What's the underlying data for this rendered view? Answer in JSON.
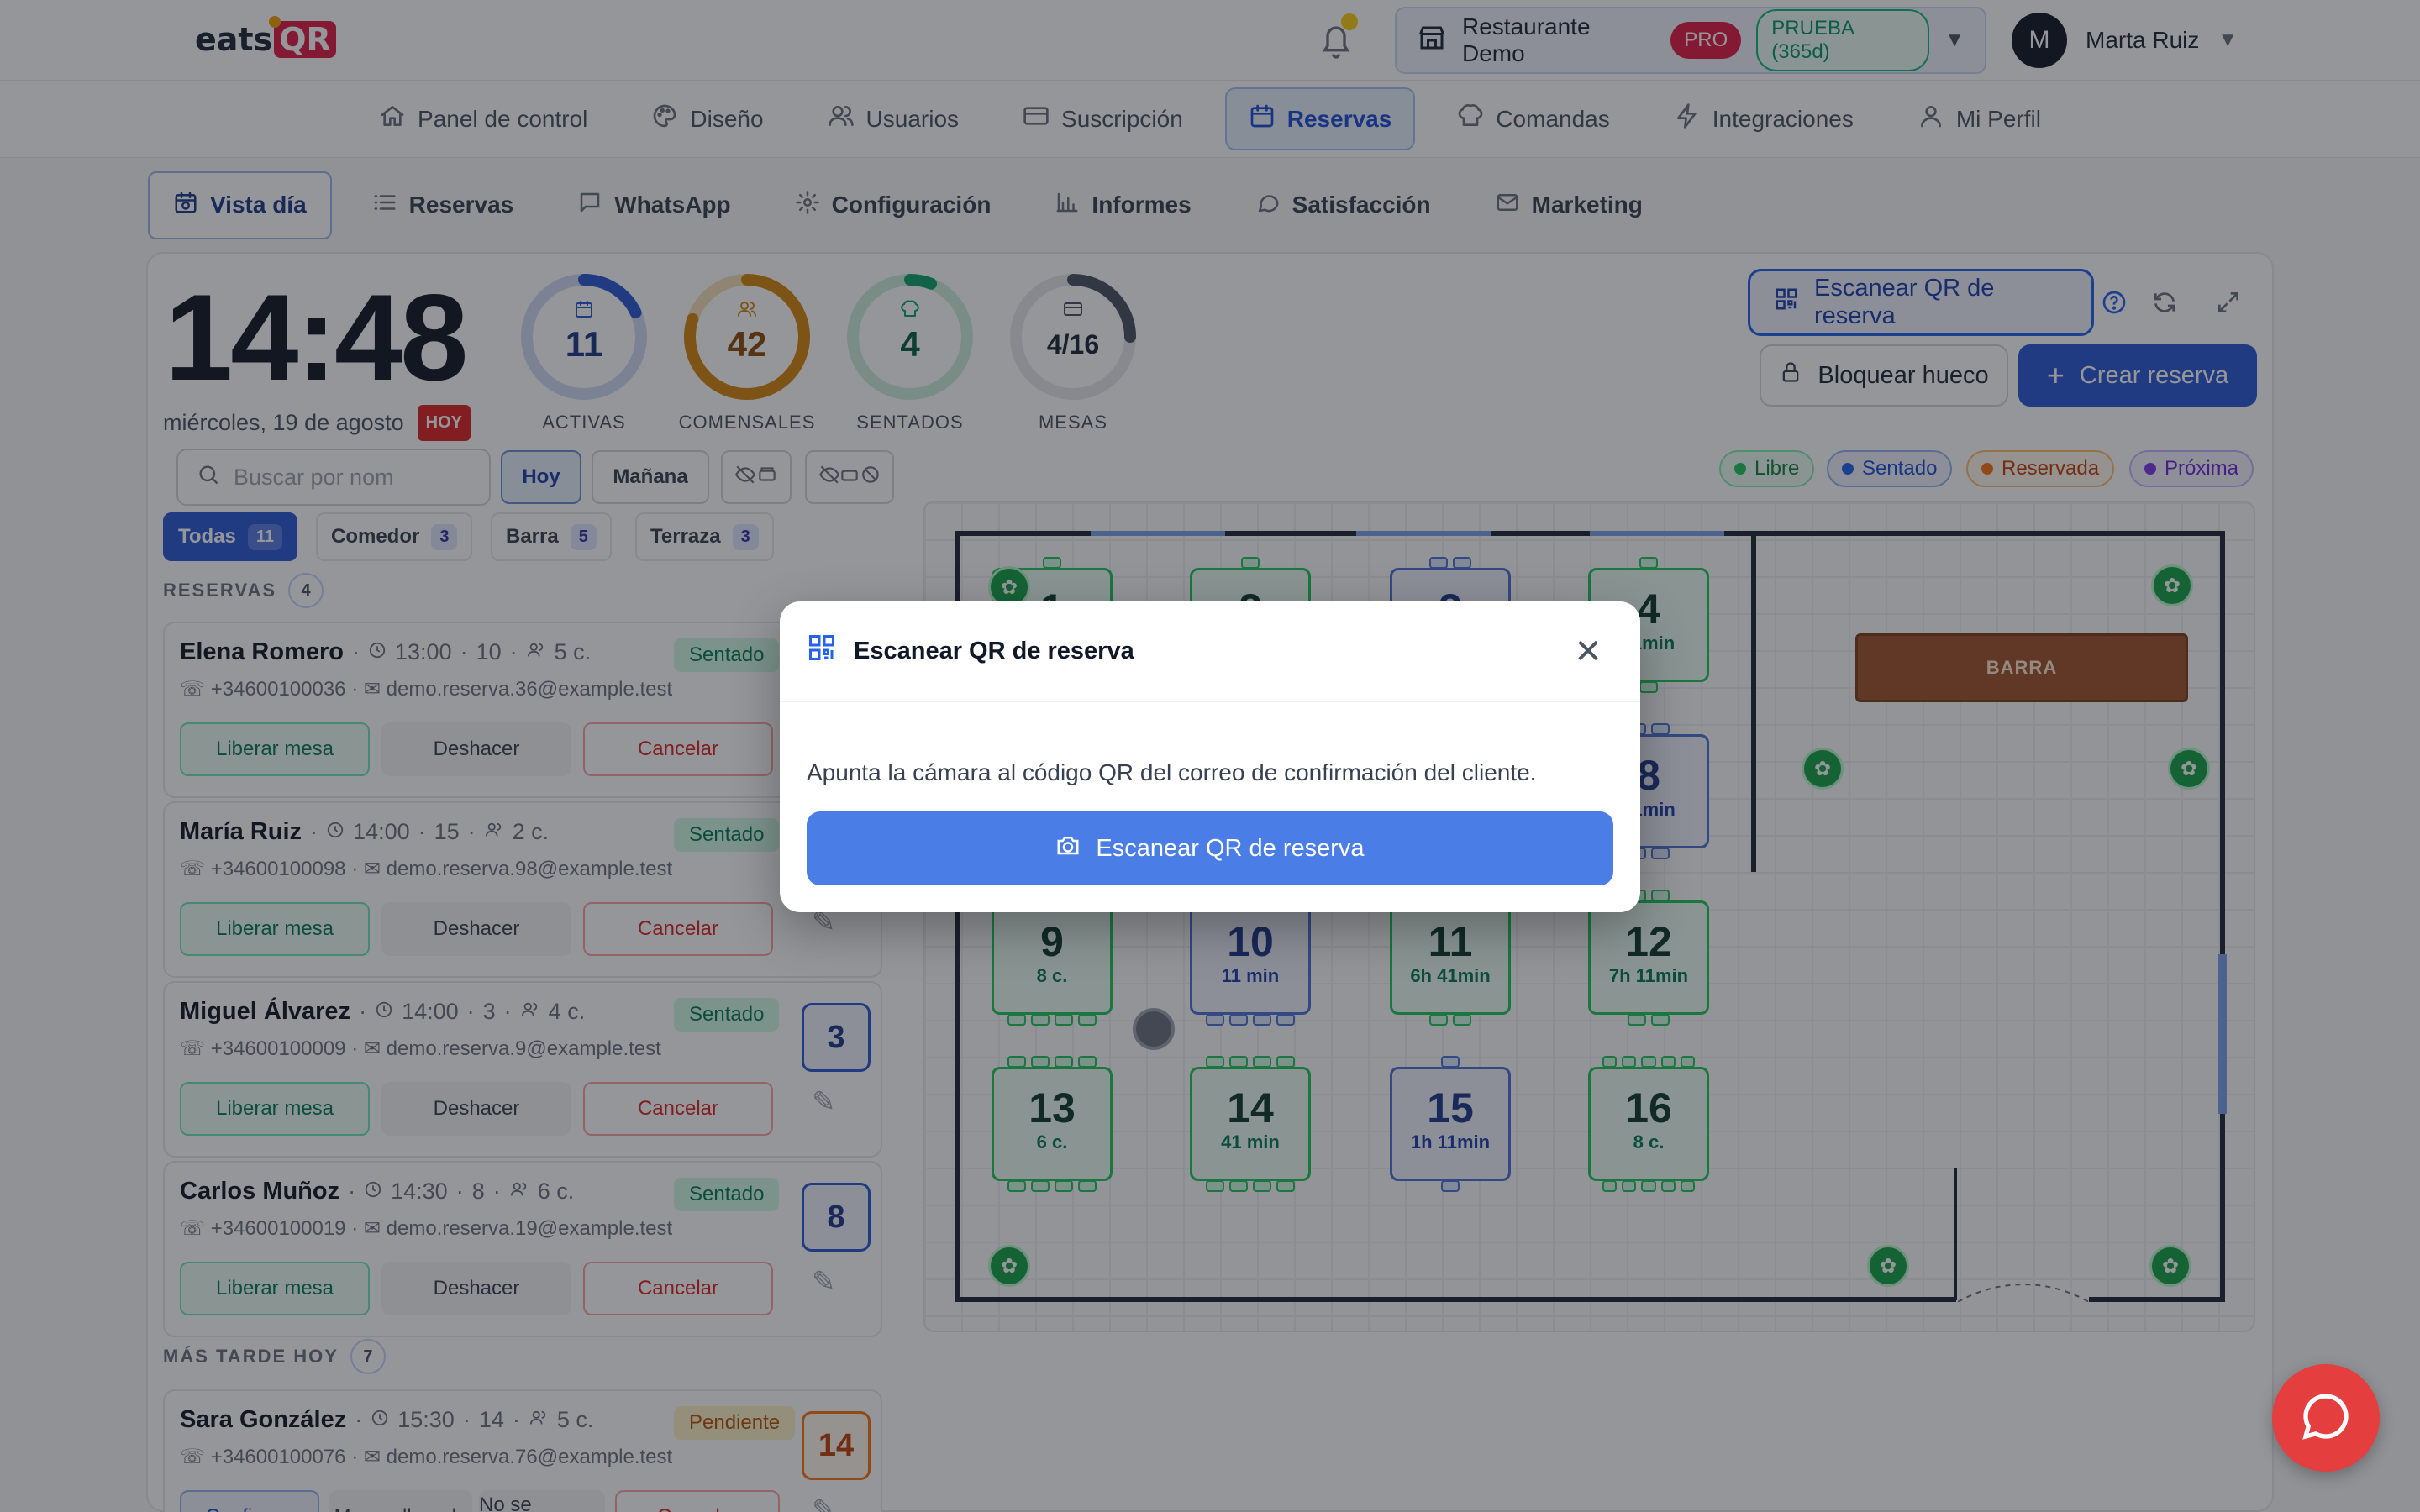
{
  "brand": {
    "logo_text": "eats",
    "logo_qr": "QR"
  },
  "header": {
    "restaurant": "Restaurante Demo",
    "pro_badge": "PRO",
    "trial_badge": "PRUEBA (365d)",
    "user_initial": "M",
    "user_name": "Marta Ruiz"
  },
  "main_nav": [
    {
      "label": "Panel de control",
      "icon": "home-icon"
    },
    {
      "label": "Diseño",
      "icon": "palette-icon"
    },
    {
      "label": "Usuarios",
      "icon": "users-icon"
    },
    {
      "label": "Suscripción",
      "icon": "credit-card-icon"
    },
    {
      "label": "Reservas",
      "icon": "calendar-icon",
      "active": true
    },
    {
      "label": "Comandas",
      "icon": "chef-hat-icon"
    },
    {
      "label": "Integraciones",
      "icon": "lightning-icon"
    },
    {
      "label": "Mi Perfil",
      "icon": "user-icon"
    }
  ],
  "sub_nav": [
    {
      "label": "Vista día",
      "icon": "calendar-clock-icon",
      "active": true
    },
    {
      "label": "Reservas",
      "icon": "list-icon"
    },
    {
      "label": "WhatsApp",
      "icon": "chat-icon"
    },
    {
      "label": "Configuración",
      "icon": "gear-icon"
    },
    {
      "label": "Informes",
      "icon": "bar-chart-icon"
    },
    {
      "label": "Satisfacción",
      "icon": "speech-bubble-icon"
    },
    {
      "label": "Marketing",
      "icon": "mail-icon"
    }
  ],
  "clock": {
    "time": "14:48",
    "date": "miércoles, 19 de agosto",
    "today": "HOY"
  },
  "stats": [
    {
      "value": "11",
      "label": "ACTIVAS",
      "progress": 0.18,
      "color": "#2b5ad6",
      "track": "#cfdaf5",
      "text": "#1e3a8a"
    },
    {
      "value": "42",
      "label": "COMENSALES",
      "progress": 0.8,
      "color": "#d4880f",
      "track": "#f6e1b8",
      "text": "#8a4b0b"
    },
    {
      "value": "4",
      "label": "SENTADOS",
      "progress": 0.06,
      "color": "#10a36b",
      "track": "#cdeedd",
      "text": "#065f46"
    },
    {
      "value": "4/16",
      "label": "MESAS",
      "progress": 0.25,
      "color": "#4b5563",
      "track": "#e5e7eb",
      "text": "#1f2937"
    }
  ],
  "actions": {
    "scan": "Escanear QR de reserva",
    "block": "Bloquear hueco",
    "create": "Crear reserva"
  },
  "filters": {
    "search_placeholder": "Buscar por nom",
    "today": "Hoy",
    "tomorrow": "Mañana"
  },
  "legend": [
    {
      "label": "Libre",
      "color": "#22c55e",
      "bg": "#ecfdf5",
      "border": "#86efac",
      "text": "#15803d"
    },
    {
      "label": "Sentado",
      "color": "#2563eb",
      "bg": "#eef3fd",
      "border": "#93b4f0",
      "text": "#1d4ed8"
    },
    {
      "label": "Reservada",
      "color": "#f97316",
      "bg": "#fff7ed",
      "border": "#fdba74",
      "text": "#c2410c"
    },
    {
      "label": "Próxima",
      "color": "#7c3aed",
      "bg": "#f5f3ff",
      "border": "#c4b5fd",
      "text": "#6d28d9"
    }
  ],
  "zone_tabs": [
    {
      "label": "Todas",
      "count": "11",
      "active": true
    },
    {
      "label": "Comedor",
      "count": "3"
    },
    {
      "label": "Barra",
      "count": "5"
    },
    {
      "label": "Terraza",
      "count": "3"
    }
  ],
  "sections": {
    "reservas": "RESERVAS",
    "reservas_count": "4",
    "later": "MÁS TARDE HOY",
    "later_count": "7"
  },
  "reservations": [
    {
      "name": "Elena Romero",
      "time": "13:00",
      "table": "10",
      "guests": "5 c.",
      "status": "Sentado",
      "phone": "+34600100036",
      "email": "demo.reserva.36@example.test"
    },
    {
      "name": "María Ruiz",
      "time": "14:00",
      "table": "15",
      "guests": "2 c.",
      "status": "Sentado",
      "phone": "+34600100098",
      "email": "demo.reserva.98@example.test"
    },
    {
      "name": "Miguel Álvarez",
      "time": "14:00",
      "table": "3",
      "guests": "4 c.",
      "status": "Sentado",
      "phone": "+34600100009",
      "email": "demo.reserva.9@example.test",
      "badge": "3"
    },
    {
      "name": "Carlos Muñoz",
      "time": "14:30",
      "table": "8",
      "guests": "6 c.",
      "status": "Sentado",
      "phone": "+34600100019",
      "email": "demo.reserva.19@example.test",
      "badge": "8"
    }
  ],
  "res_buttons": {
    "release": "Liberar mesa",
    "undo": "Deshacer",
    "cancel": "Cancelar"
  },
  "later_reservations": [
    {
      "name": "Sara González",
      "time": "15:30",
      "table": "14",
      "guests": "5 c.",
      "status": "Pendiente",
      "phone": "+34600100076",
      "email": "demo.reserva.76@example.test",
      "badge": "14"
    }
  ],
  "later_buttons": {
    "confirm": "Confirmar",
    "arrived": "Marcar llegada",
    "noshow": "No se presentó",
    "cancel": "Cancelar"
  },
  "tables": [
    {
      "n": "1",
      "sub": "",
      "kind": "green"
    },
    {
      "n": "2",
      "sub": "",
      "kind": "green"
    },
    {
      "n": "3",
      "sub": "",
      "kind": "blue"
    },
    {
      "n": "4",
      "sub": "11min",
      "kind": "green"
    },
    {
      "n": "8",
      "sub": "41min",
      "kind": "blue"
    },
    {
      "n": "9",
      "sub": "8 c.",
      "kind": "green"
    },
    {
      "n": "10",
      "sub": "11 min",
      "kind": "blue"
    },
    {
      "n": "11",
      "sub": "6h 41min",
      "kind": "green"
    },
    {
      "n": "12",
      "sub": "7h 11min",
      "kind": "green"
    },
    {
      "n": "13",
      "sub": "6 c.",
      "kind": "green"
    },
    {
      "n": "14",
      "sub": "41 min",
      "kind": "green"
    },
    {
      "n": "15",
      "sub": "1h 11min",
      "kind": "blue"
    },
    {
      "n": "16",
      "sub": "8 c.",
      "kind": "green"
    }
  ],
  "bar_label": "BARRA",
  "modal": {
    "title": "Escanear QR de reserva",
    "description": "Apunta la cámara al código QR del correo de confirmación del cliente.",
    "button": "Escanear QR de reserva"
  }
}
